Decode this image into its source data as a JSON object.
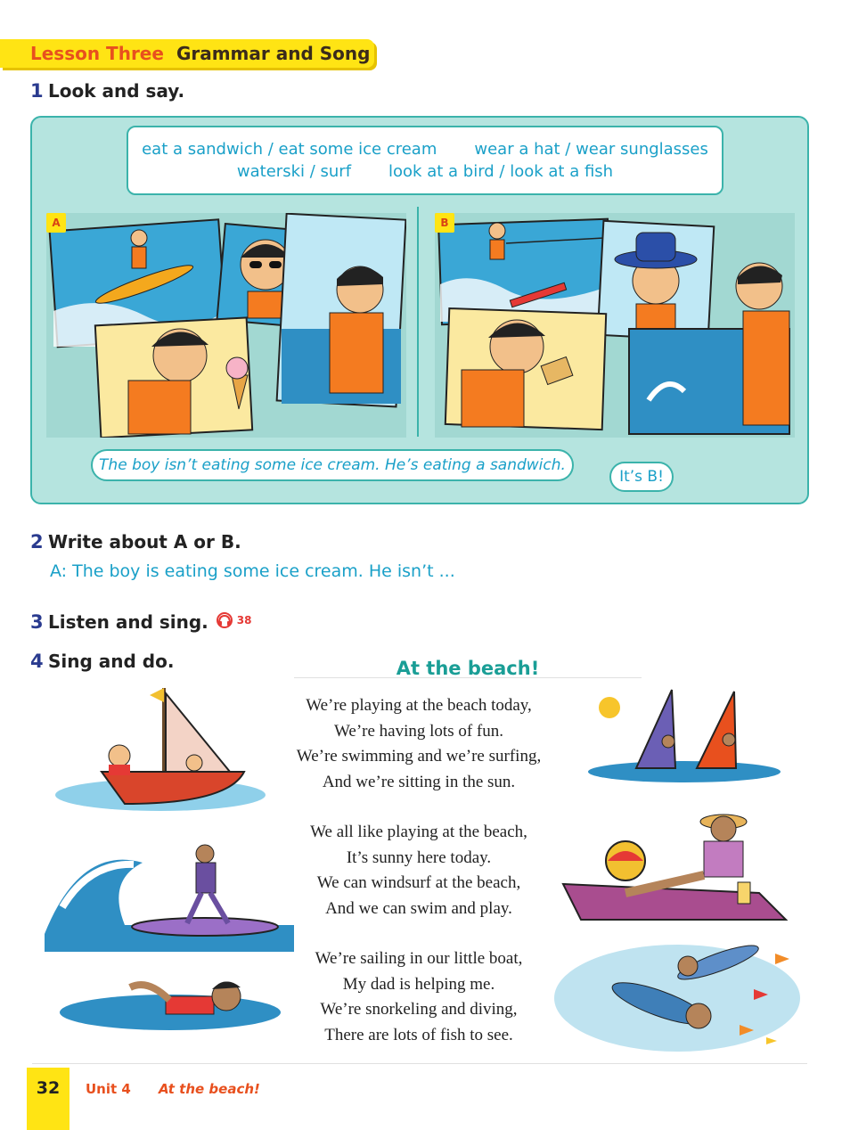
{
  "header": {
    "lesson": "Lesson Three",
    "title": "Grammar and Song"
  },
  "exercises": [
    {
      "number": "1",
      "text": "Look and say."
    },
    {
      "number": "2",
      "text": "Write about A or B."
    },
    {
      "number": "3",
      "text": "Listen and sing."
    },
    {
      "number": "4",
      "text": "Sing and do."
    }
  ],
  "word_box": {
    "row1": [
      "eat a sandwich / eat some ice cream",
      "wear a hat / wear sunglasses"
    ],
    "row2": [
      "waterski / surf",
      "look at a bird / look at a fish"
    ]
  },
  "scenes": {
    "a_label": "A",
    "b_label": "B"
  },
  "bubbles": {
    "main": "The boy isn’t eating some ice cream. He’s eating a sandwich.",
    "reply": "It’s B!"
  },
  "write_example": "A: The boy is eating some ice cream. He isn’t ...",
  "audio_track": "38",
  "song": {
    "title": "At the beach!",
    "verses": [
      [
        "We’re playing at the beach today,",
        "We’re having lots of fun.",
        "We’re swimming and we’re surfing,",
        "And we’re sitting in the sun."
      ],
      [
        "We all like playing at the beach,",
        "It’s sunny here today.",
        "We can windsurf at the beach,",
        "And we can swim and play."
      ],
      [
        "We’re sailing in our little boat,",
        "My dad is helping me.",
        "We’re snorkeling and diving,",
        "There are lots of fish to see."
      ]
    ]
  },
  "footer": {
    "page": "32",
    "unit": "Unit 4",
    "title": "At the beach!"
  },
  "colors": {
    "accent_yellow": "#ffe414",
    "teal": "#3bb3ab",
    "blue_text": "#1aa0c8",
    "orange": "#e8501e",
    "navy": "#2a3b8f"
  },
  "icons": [
    "headphones-icon"
  ]
}
